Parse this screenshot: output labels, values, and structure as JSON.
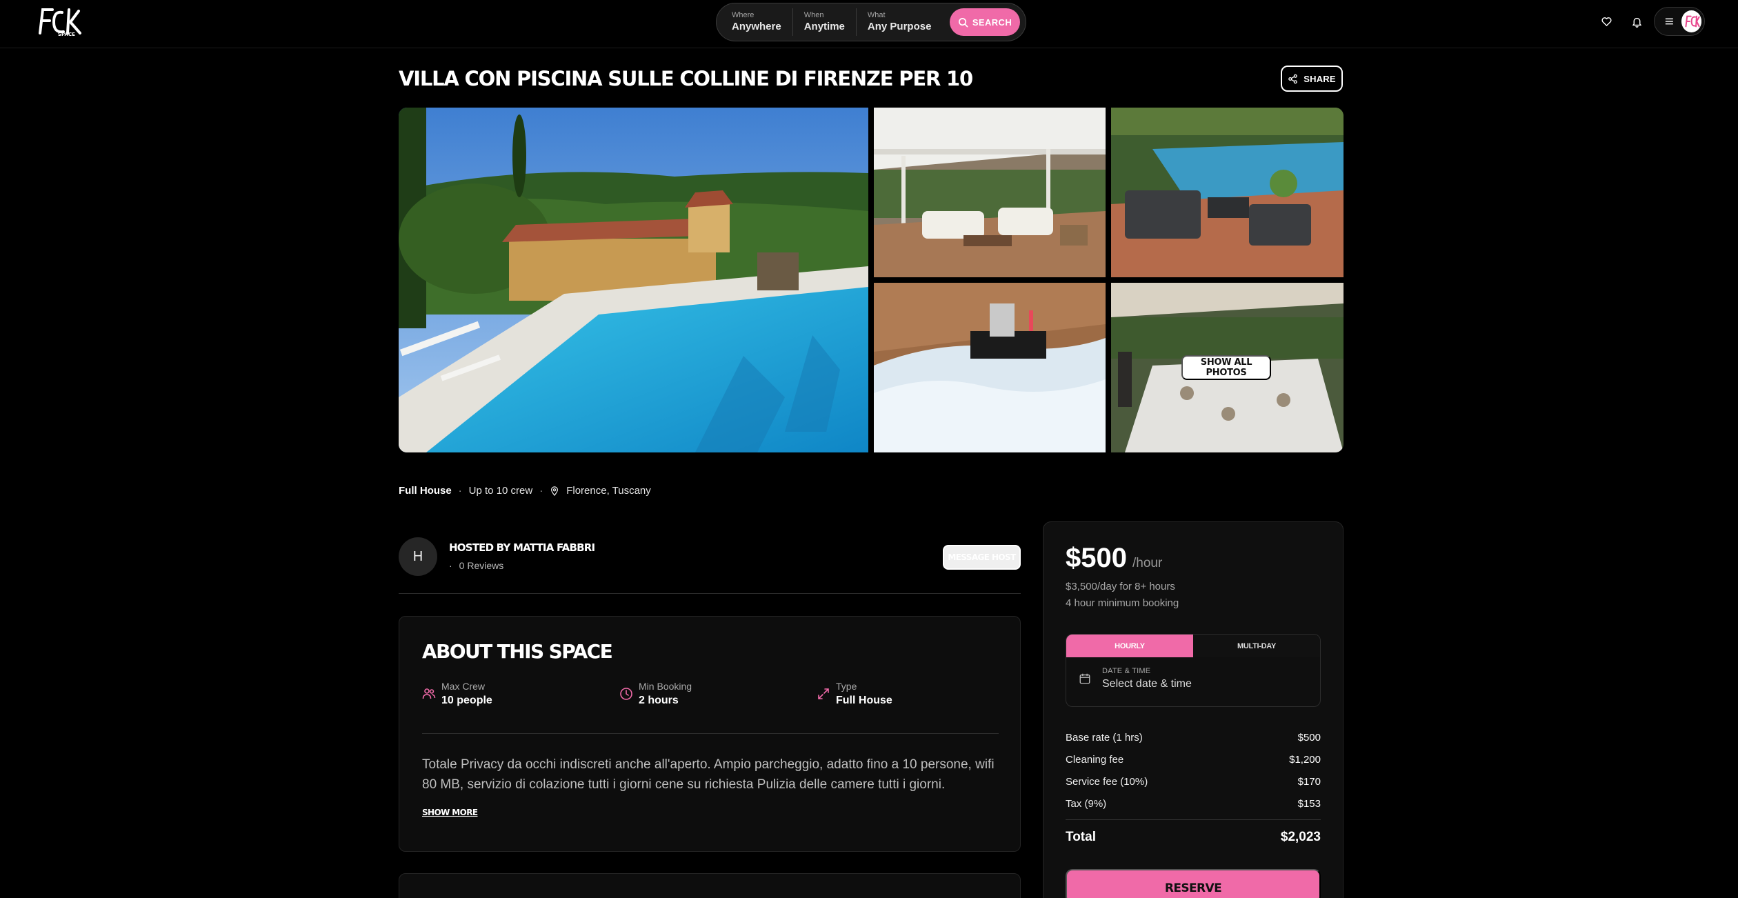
{
  "header": {
    "logo_text": "FCK SPACE",
    "search": {
      "where": {
        "caption": "Where",
        "value": "Anywhere"
      },
      "when": {
        "caption": "When",
        "value": "Anytime"
      },
      "what": {
        "caption": "What",
        "value": "Any Purpose"
      },
      "button_label": "SEARCH"
    },
    "icons": [
      "heart-icon",
      "bell-icon",
      "menu-icon"
    ]
  },
  "listing": {
    "title": "VILLA CON PISCINA SULLE COLLINE DI FIRENZE PER 10",
    "share_label": "SHARE",
    "show_all_photos_label": "SHOW ALL PHOTOS",
    "meta": {
      "type": "Full House",
      "crew": "Up to 10 crew",
      "location": "Florence, Tuscany"
    }
  },
  "host": {
    "initial": "H",
    "name": "HOSTED BY MATTIA FABBRI",
    "reviews_sep": "·",
    "reviews": "0 Reviews",
    "message_label": "MESSAGE HOST"
  },
  "about": {
    "heading": "ABOUT THIS SPACE",
    "stats": [
      {
        "caption": "Max Crew",
        "value": "10 people",
        "icon": "users-icon"
      },
      {
        "caption": "Min Booking",
        "value": "2 hours",
        "icon": "clock-icon"
      },
      {
        "caption": "Type",
        "value": "Full House",
        "icon": "expand-icon"
      }
    ],
    "description": "Totale Privacy da occhi indiscreti anche all'aperto. Ampio parcheggio, adatto fino a 10 persone, wifi 80 MB, servizio di colazione tutti i giorni cene su richiesta Pulizia delle camere tutti i giorni.",
    "show_more_label": "SHOW MORE"
  },
  "booking": {
    "price": "$500",
    "unit": "/hour",
    "day_rate": "$3,500/day for 8+ hours",
    "minimum": "4 hour minimum booking",
    "tabs": [
      "HOURLY",
      "MULTI-DAY"
    ],
    "active_tab": "HOURLY",
    "date_caption": "DATE & TIME",
    "date_value": "Select date & time",
    "fees": [
      {
        "label": "Base rate (1 hrs)",
        "value": "$500"
      },
      {
        "label": "Cleaning fee",
        "value": "$1,200"
      },
      {
        "label": "Service fee (10%)",
        "value": "$170"
      },
      {
        "label": "Tax (9%)",
        "value": "$153"
      }
    ],
    "total_label": "Total",
    "total_value": "$2,023",
    "reserve_label": "RESERVE"
  },
  "colors": {
    "accent": "#f06aa8",
    "background": "#000000",
    "card": "#0d0d0d"
  }
}
